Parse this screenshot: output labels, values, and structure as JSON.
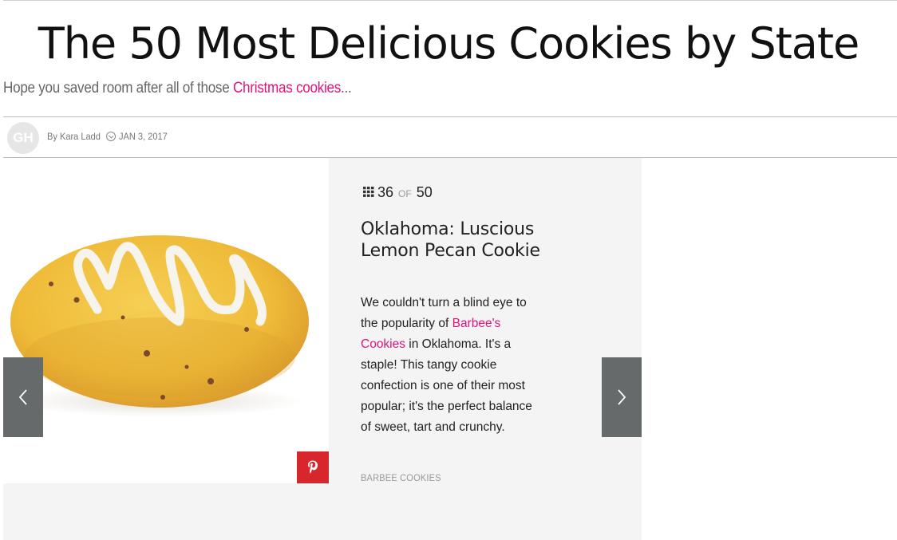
{
  "article": {
    "title": "The 50 Most Delicious Cookies by State",
    "dek_prefix": "Hope you saved room after all of those ",
    "dek_link": "Christmas cookies",
    "dek_suffix": "..."
  },
  "byline": {
    "avatar_text": "GH",
    "author": "By Kara Ladd",
    "date": "JAN 3, 2017"
  },
  "slide": {
    "current": "36",
    "of_label": "OF",
    "total": "50",
    "title": "Oklahoma: Luscious Lemon Pecan Cookie",
    "body_part1": "We couldn't turn a blind eye to the popularity of ",
    "body_link": "Barbee's Cookies",
    "body_part2": " in Oklahoma. It's a staple!  This tangy cookie confection is one of their most popular; it's the perfect balance of sweet, tart and crunchy.",
    "credit": "BARBEE COOKIES"
  },
  "icons": {
    "prev": "chevron-left-icon",
    "next": "chevron-right-icon",
    "pin": "pinterest-icon",
    "grid": "grid-icon",
    "clock": "clock-icon"
  },
  "colors": {
    "accent_link": "#e0147c",
    "pinterest": "#d7262c",
    "arrow_bg": "#666a6b",
    "slide_bg": "#f4f4f4"
  }
}
